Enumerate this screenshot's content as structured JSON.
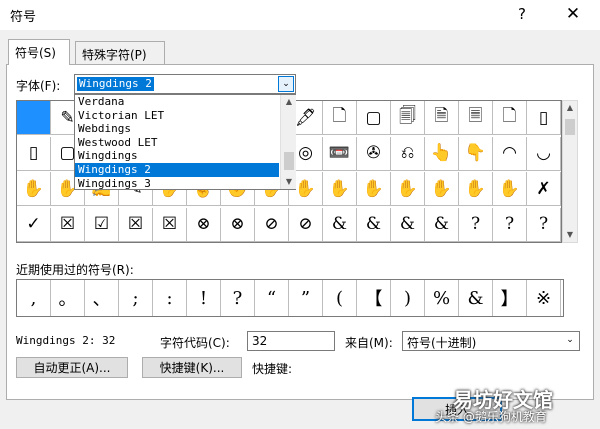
{
  "window": {
    "title": "符号",
    "help_label": "?",
    "close_label": "✕"
  },
  "tabs": [
    {
      "label": "符号(S)",
      "active": true
    },
    {
      "label": "特殊字符(P)",
      "active": false
    }
  ],
  "font_label": "字体(F):",
  "font_value": "Wingdings 2",
  "font_list": {
    "items": [
      "Verdana",
      "Victorian LET",
      "Webdings",
      "Westwood LET",
      "Wingdings",
      "Wingdings 2",
      "Wingdings 3"
    ],
    "selected": "Wingdings 2"
  },
  "symbol_grid": [
    [
      "",
      "✎",
      "✒",
      "✌",
      "☞",
      "☜",
      "☝",
      "☟",
      "🖋",
      "🗋",
      "▢",
      "🗐",
      "🗎",
      "🗏",
      "🗋",
      "▯"
    ],
    [
      "▯",
      "▢",
      "◫",
      "⌧",
      "⌨",
      "⌫",
      "☐",
      "⌽",
      "◎",
      "📼",
      "✇",
      "⎌",
      "👆",
      "👇",
      "◠",
      "◡"
    ],
    [
      "✋",
      "✋",
      "✍",
      "✎",
      "✋",
      "✌",
      "✊",
      "✋",
      "✋",
      "✋",
      "✋",
      "✋",
      "✋",
      "✋",
      "✋",
      "✗"
    ],
    [
      "✓",
      "☒",
      "☑",
      "☒",
      "☒",
      "⊗",
      "⊗",
      "⊘",
      "⊘",
      "&",
      "&",
      "&",
      "&",
      "?",
      "?",
      "?"
    ]
  ],
  "recent_label": "近期使用过的符号(R):",
  "recent_symbols": [
    ",",
    "。",
    "、",
    ";",
    ":",
    "!",
    "?",
    "“",
    "”",
    "(",
    "【",
    ")",
    "%",
    "&",
    "】",
    "※"
  ],
  "char_name": "Wingdings 2: 32",
  "char_code_label": "字符代码(C):",
  "char_code_value": "32",
  "from_label": "来自(M):",
  "from_value": "符号(十进制)",
  "buttons": {
    "autocorrect": "自动更正(A)...",
    "shortcut_key": "快捷键(K)...",
    "shortcut_label": "快捷键:",
    "insert": "插入"
  },
  "watermark": {
    "big": "易坊好文馆",
    "small": "头条 @鹅乐狗机教育"
  },
  "colors": {
    "selection": "#0078d7",
    "selected_cell": "#1e90ff"
  },
  "icons": {
    "scroll_up": "▲",
    "scroll_down": "▼",
    "combo_arrow": "⌄"
  }
}
